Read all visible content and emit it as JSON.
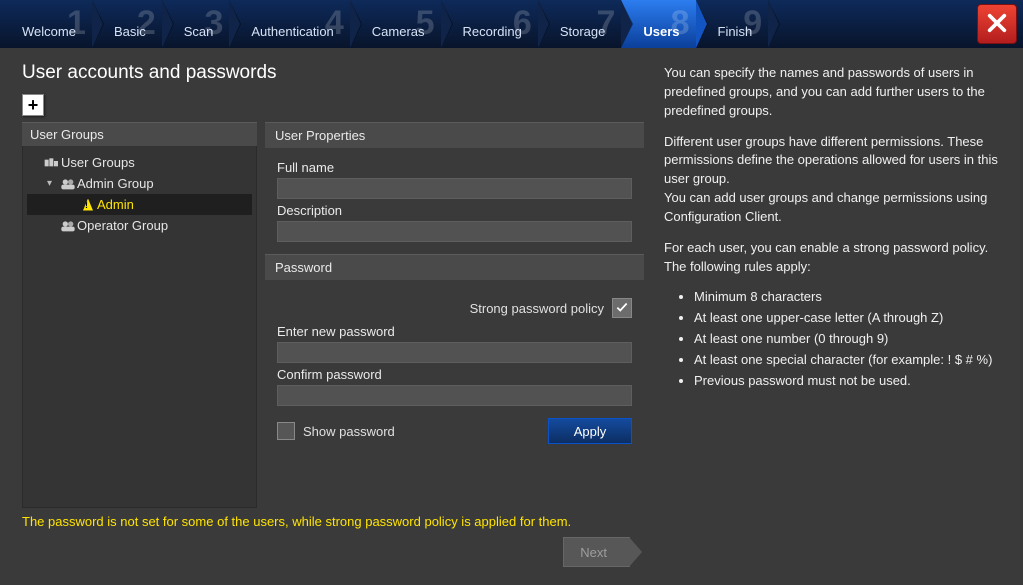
{
  "steps": [
    {
      "num": "1",
      "label": "Welcome"
    },
    {
      "num": "2",
      "label": "Basic"
    },
    {
      "num": "3",
      "label": "Scan"
    },
    {
      "num": "4",
      "label": "Authentication"
    },
    {
      "num": "5",
      "label": "Cameras"
    },
    {
      "num": "6",
      "label": "Recording"
    },
    {
      "num": "7",
      "label": "Storage"
    },
    {
      "num": "8",
      "label": "Users"
    },
    {
      "num": "9",
      "label": "Finish"
    }
  ],
  "active_step_index": 7,
  "page_title": "User accounts and passwords",
  "tree": {
    "header": "User Groups",
    "root": "User Groups",
    "admin_group": "Admin Group",
    "admin_user": "Admin",
    "operator_group": "Operator Group"
  },
  "props": {
    "header": "User Properties",
    "full_name_label": "Full name",
    "full_name_value": "",
    "description_label": "Description",
    "description_value": ""
  },
  "password": {
    "header": "Password",
    "spp_label": "Strong password policy",
    "spp_checked": true,
    "enter_label": "Enter new password",
    "enter_value": "",
    "confirm_label": "Confirm password",
    "confirm_value": "",
    "show_label": "Show password",
    "show_checked": false,
    "apply_label": "Apply"
  },
  "warning_text": "The password is not set for some of the users, while strong password policy is applied for them.",
  "next_label": "Next",
  "help": {
    "p1": "You can specify the names and passwords of users in predefined groups, and you can add further users to the predefined groups.",
    "p2": "Different user groups have different permissions. These permissions define the operations allowed for users in this user group.",
    "p3": "You can add user groups and change permissions using Configuration Client.",
    "p4": "For each user, you can enable a strong password policy. The following rules apply:",
    "rules": [
      "Minimum 8 characters",
      "At least one upper-case letter (A through Z)",
      "At least one number (0 through 9)",
      "At least one special character (for example: ! $ # %)",
      "Previous password must not be used."
    ]
  }
}
